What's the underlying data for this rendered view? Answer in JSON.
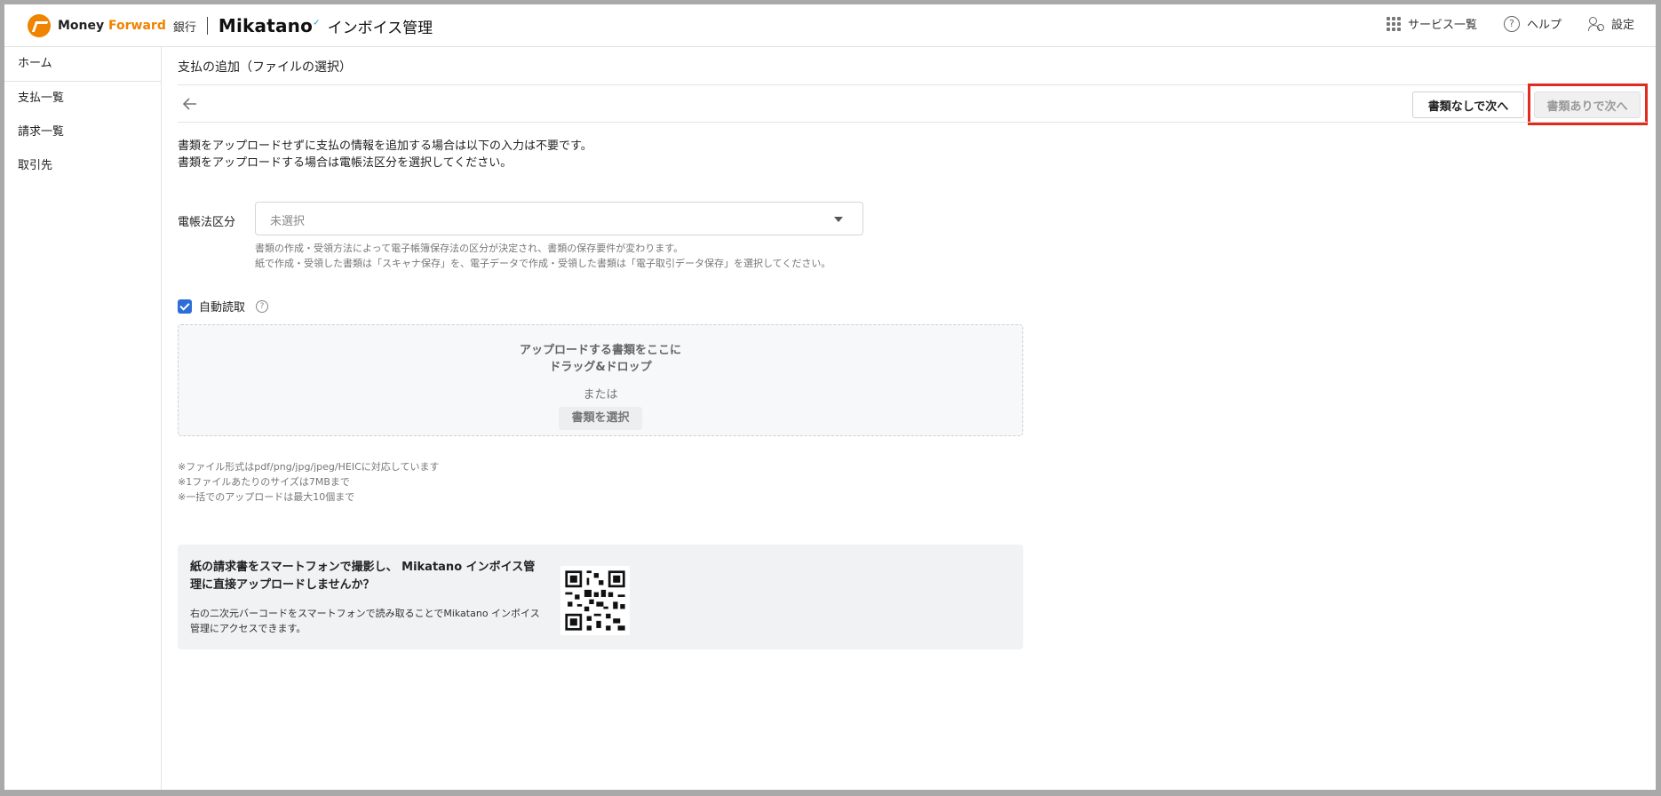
{
  "header": {
    "brand_money": "Money ",
    "brand_forward": "Forward",
    "brand_bank": "銀行",
    "brand_mikatano": "Mikatano",
    "brand_product": "インボイス管理",
    "services": "サービス一覧",
    "help": "ヘルプ",
    "settings": "設定"
  },
  "sidebar": {
    "items": [
      {
        "label": "ホーム"
      },
      {
        "label": "支払一覧"
      },
      {
        "label": "請求一覧"
      },
      {
        "label": "取引先"
      }
    ]
  },
  "main": {
    "title": "支払の追加（ファイルの選択）",
    "next_without_file": "書類なしで次へ",
    "next_with_file": "書類ありで次へ",
    "intro_line1": "書類をアップロードせずに支払の情報を追加する場合は以下の入力は不要です。",
    "intro_line2": "書類をアップロードする場合は電帳法区分を選択してください。",
    "field_label": "電帳法区分",
    "select_value": "未選択",
    "hint_line1": "書類の作成・受領方法によって電子帳簿保存法の区分が決定され、書類の保存要件が変わります。",
    "hint_line2": "紙で作成・受領した書類は「スキャナ保存」を、電子データで作成・受領した書類は「電子取引データ保存」を選択してください。",
    "auto_read": "自動読取",
    "dropzone_line1": "アップロードする書類をここに",
    "dropzone_line2": "ドラッグ&ドロップ",
    "dropzone_or": "または",
    "select_file": "書類を選択",
    "note1": "※ファイル形式はpdf/png/jpg/jpeg/HEICに対応しています",
    "note2": "※1ファイルあたりのサイズは7MBまで",
    "note3": "※一括でのアップロードは最大10個まで",
    "promo_title": "紙の請求書をスマートフォンで撮影し、 Mikatano インボイス管理に直接アップロードしませんか？",
    "promo_text": "右の二次元バーコードをスマートフォンで読み取ることでMikatano インボイス管理にアクセスできます。"
  },
  "colors": {
    "brand_orange": "#f08300",
    "checkbox_blue": "#2d6dd7",
    "highlight_red": "#e12b1e"
  }
}
